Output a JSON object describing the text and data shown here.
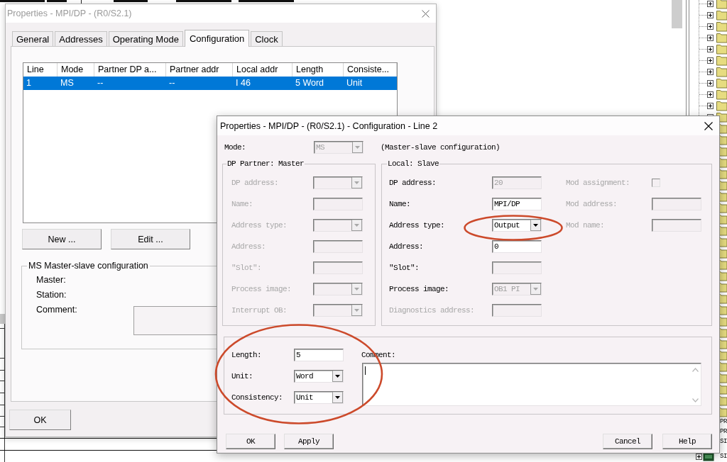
{
  "background": {
    "tree_labels": [
      "PR",
      "PR",
      "SI",
      "SI"
    ]
  },
  "properties_window": {
    "title": "Properties - MPI/DP - (R0/S2.1)",
    "active": false,
    "tabs": [
      {
        "label": "General",
        "selected": false
      },
      {
        "label": "Addresses",
        "selected": false
      },
      {
        "label": "Operating Mode",
        "selected": false
      },
      {
        "label": "Configuration",
        "selected": true
      },
      {
        "label": "Clock",
        "selected": false
      }
    ],
    "table": {
      "columns": [
        "Line",
        "Mode",
        "Partner DP a...",
        "Partner addr",
        "Local addr",
        "Length",
        "Consiste..."
      ],
      "rows": [
        {
          "cells": [
            "1",
            "MS",
            "--",
            "--",
            "I 46",
            "5 Word",
            "Unit"
          ],
          "selected": true
        }
      ]
    },
    "buttons": [
      "New ...",
      "Edit ..."
    ],
    "group": {
      "title": "MS Master-slave configuration",
      "fields": [
        {
          "label": "Master:",
          "kind": "info"
        },
        {
          "label": "Station:",
          "kind": "info"
        },
        {
          "label": "Comment:",
          "kind": "memo"
        }
      ]
    },
    "footer_buttons": [
      "OK"
    ]
  },
  "line_window": {
    "title": "Properties - MPI/DP - (R0/S2.1) - Configuration - Line 2",
    "active": true,
    "mode": {
      "label": "Mode:",
      "label_disabled": false,
      "kind": "combo",
      "value": "MS",
      "disabled": true
    },
    "mode_description": "(Master-slave configuration)",
    "partner_group": {
      "title": "DP Partner: Master",
      "fields": [
        {
          "label": "DP address:",
          "label_disabled": true,
          "kind": "combo",
          "disabled": true
        },
        {
          "label": "Name:",
          "label_disabled": true,
          "kind": "text",
          "disabled": true
        },
        {
          "label": "Address type:",
          "label_disabled": true,
          "kind": "combo",
          "disabled": true
        },
        {
          "label": "Address:",
          "label_disabled": true,
          "kind": "text",
          "disabled": true
        },
        {
          "label": "\"Slot\":",
          "label_disabled": true,
          "kind": "text",
          "disabled": true
        },
        {
          "label": "Process image:",
          "label_disabled": true,
          "kind": "combo",
          "disabled": true
        },
        {
          "label": "Interrupt OB:",
          "label_disabled": true,
          "kind": "combo",
          "disabled": true
        }
      ]
    },
    "local_group": {
      "title": "Local: Slave",
      "fields": [
        {
          "label": "DP address:",
          "label_disabled": false,
          "kind": "text",
          "value": "20",
          "disabled": true,
          "circled": false
        },
        {
          "label": "Name:",
          "label_disabled": false,
          "kind": "text",
          "value": "MPI/DP",
          "disabled": false,
          "circled": false
        },
        {
          "label": "Address type:",
          "label_disabled": false,
          "kind": "combo",
          "value": "Output",
          "disabled": false,
          "circled": true
        },
        {
          "label": "Address:",
          "label_disabled": false,
          "kind": "text",
          "value": "0",
          "disabled": false,
          "circled": false
        },
        {
          "label": "\"Slot\":",
          "label_disabled": false,
          "kind": "text",
          "disabled": true,
          "circled": false
        },
        {
          "label": "Process image:",
          "label_disabled": false,
          "kind": "combo",
          "value": "OB1 PI",
          "disabled": true,
          "circled": false
        },
        {
          "label": "Diagnostics address:",
          "label_disabled": true,
          "kind": "text",
          "disabled": true,
          "circled": false
        }
      ],
      "extra_fields": [
        {
          "label": "Mod assignment:",
          "label_disabled": true,
          "kind": "checkbox",
          "checked": false,
          "disabled": true
        },
        {
          "label": "Mod address:",
          "label_disabled": true,
          "kind": "text",
          "disabled": true
        },
        {
          "label": "Mod name:",
          "label_disabled": true,
          "kind": "text",
          "disabled": true
        }
      ]
    },
    "data_group": {
      "circled": true,
      "fields": [
        {
          "label": "Length:",
          "kind": "text",
          "value": "5"
        },
        {
          "label": "Unit:",
          "kind": "combo",
          "value": "Word"
        },
        {
          "label": "Consistency:",
          "kind": "combo",
          "value": "Unit"
        }
      ],
      "comment": {
        "label": "Comment:",
        "focused": true
      }
    },
    "buttons": {
      "left": [
        "OK",
        "Apply"
      ],
      "right": [
        "Cancel",
        "Help"
      ]
    }
  }
}
